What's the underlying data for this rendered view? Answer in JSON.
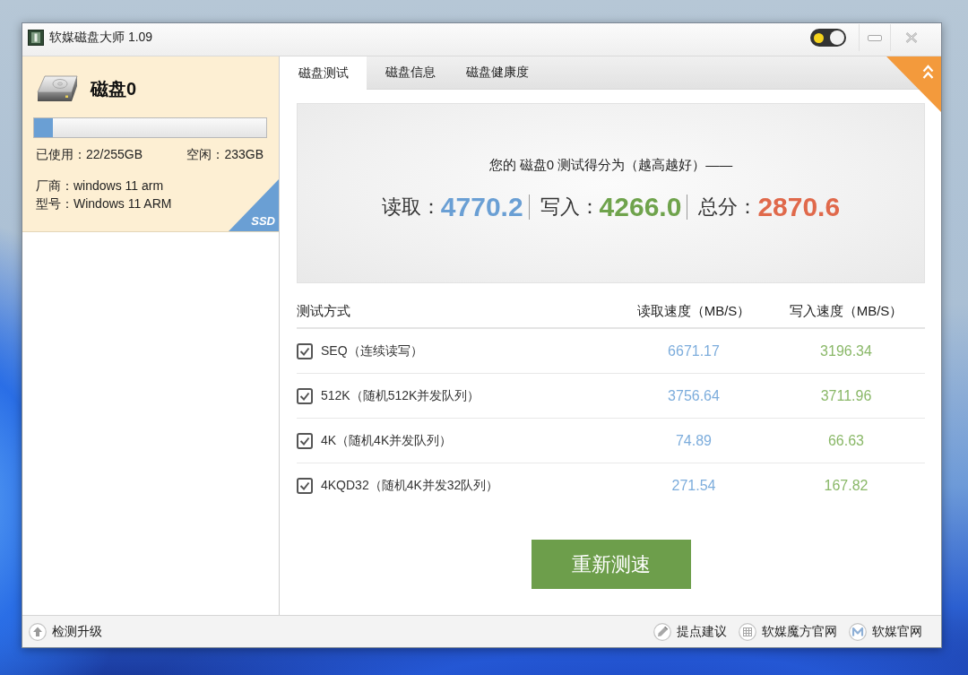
{
  "window": {
    "title": "软媒磁盘大师 1.09",
    "theme_switch": {
      "on": true
    }
  },
  "disk": {
    "name": "磁盘0",
    "usage": {
      "level": 0.08
    },
    "used": "已使用：22/255GB",
    "free": "空闲：233GB",
    "vendor": "厂商：windows 11 arm",
    "model": "型号：Windows 11 ARM",
    "type_badge": "SSD"
  },
  "tabs": [
    {
      "label": "磁盘测试",
      "selected": true
    },
    {
      "label": "磁盘信息",
      "selected": false
    },
    {
      "label": "磁盘健康度",
      "selected": false
    }
  ],
  "score": {
    "caption": "您的 磁盘0 测试得分为（越高越好）——",
    "items": [
      {
        "label": "读取：",
        "value": "4770.2",
        "color": "#6a9fd4"
      },
      {
        "label": "写入：",
        "value": "4266.0",
        "color": "#6fa34c"
      },
      {
        "label": "总分：",
        "value": "2870.6",
        "color": "#e0694b"
      }
    ]
  },
  "table": {
    "columns": [
      "测试方式",
      "读取速度（MB/S）",
      "写入速度（MB/S）"
    ],
    "rows": [
      {
        "checked": true,
        "test": "SEQ（连续读写）",
        "read": "6671.17",
        "write": "3196.34"
      },
      {
        "checked": true,
        "test": "512K（随机512K并发队列）",
        "read": "3756.64",
        "write": "3711.96"
      },
      {
        "checked": true,
        "test": "4K（随机4K并发队列）",
        "read": "74.89",
        "write": "66.63"
      },
      {
        "checked": true,
        "test": "4KQD32（随机4K并发32队列）",
        "read": "271.54",
        "write": "167.82"
      }
    ]
  },
  "retest_button": "重新测速",
  "footer": {
    "update": "检测升级",
    "links": [
      "提点建议",
      "软媒魔方官网",
      "软媒官网"
    ]
  }
}
